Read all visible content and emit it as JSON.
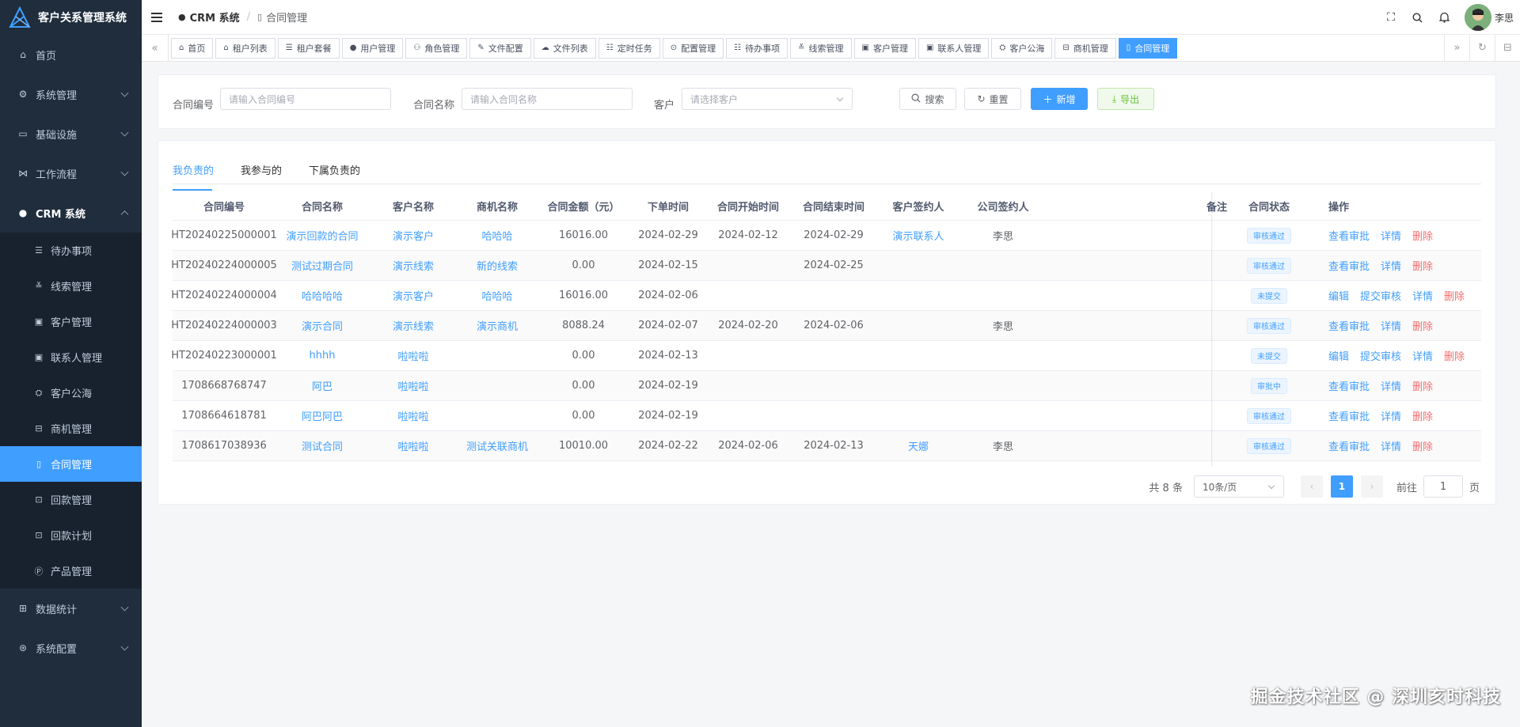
{
  "app": {
    "title": "客户关系管理系统"
  },
  "sidebar": {
    "items": [
      {
        "label": "首页",
        "icon": "home-icon"
      },
      {
        "label": "系统管理",
        "icon": "gear-icon",
        "arrow": "down"
      },
      {
        "label": "基础设施",
        "icon": "monitor-icon",
        "arrow": "down"
      },
      {
        "label": "工作流程",
        "icon": "flow-icon",
        "arrow": "down"
      },
      {
        "label": "CRM 系统",
        "icon": "user-icon",
        "arrow": "up"
      }
    ],
    "sub_items": [
      {
        "label": "待办事项",
        "icon": "list-icon"
      },
      {
        "label": "线索管理",
        "icon": "clue-icon"
      },
      {
        "label": "客户管理",
        "icon": "customer-icon"
      },
      {
        "label": "联系人管理",
        "icon": "contact-icon"
      },
      {
        "label": "客户公海",
        "icon": "sea-icon"
      },
      {
        "label": "商机管理",
        "icon": "business-icon"
      },
      {
        "label": "合同管理",
        "icon": "contract-icon"
      },
      {
        "label": "回款管理",
        "icon": "payment-icon"
      },
      {
        "label": "回款计划",
        "icon": "plan-icon"
      },
      {
        "label": "产品管理",
        "icon": "product-icon"
      }
    ],
    "bottom_items": [
      {
        "label": "数据统计",
        "icon": "chart-icon",
        "arrow": "down"
      },
      {
        "label": "系统配置",
        "icon": "config-icon",
        "arrow": "down"
      }
    ]
  },
  "navbar": {
    "breadcrumb": [
      "CRM 系统",
      "合同管理"
    ],
    "user_name": "李思"
  },
  "tags": [
    "首页",
    "租户列表",
    "租户套餐",
    "用户管理",
    "角色管理",
    "文件配置",
    "文件列表",
    "定时任务",
    "配置管理",
    "待办事项",
    "线索管理",
    "客户管理",
    "联系人管理",
    "客户公海",
    "商机管理",
    "合同管理"
  ],
  "search": {
    "contract_no_label": "合同编号",
    "contract_no_placeholder": "请输入合同编号",
    "contract_name_label": "合同名称",
    "contract_name_placeholder": "请输入合同名称",
    "customer_label": "客户",
    "customer_placeholder": "请选择客户",
    "search_btn": "搜索",
    "reset_btn": "重置",
    "add_btn": "新增",
    "export_btn": "导出"
  },
  "tabs": [
    "我负责的",
    "我参与的",
    "下属负责的"
  ],
  "table": {
    "columns": [
      "合同编号",
      "合同名称",
      "客户名称",
      "商机名称",
      "合同金额（元）",
      "下单时间",
      "合同开始时间",
      "合同结束时间",
      "客户签约人",
      "公司签约人",
      "备注",
      "合同状态",
      "操作"
    ],
    "rows": [
      {
        "no": "HT20240225000001",
        "name": "演示回款的合同",
        "customer": "演示客户",
        "business": "哈哈哈",
        "amount": "16016.00",
        "order": "2024-02-29",
        "start": "2024-02-12",
        "end": "2024-02-29",
        "cust_signer": "演示联系人",
        "comp_signer": "李思",
        "remark": "",
        "status": "审核通过",
        "ops": [
          "查看审批",
          "详情",
          "删除"
        ]
      },
      {
        "no": "HT20240224000005",
        "name": "测试过期合同",
        "customer": "演示线索",
        "business": "新的线索",
        "amount": "0.00",
        "order": "2024-02-15",
        "start": "",
        "end": "2024-02-25",
        "cust_signer": "",
        "comp_signer": "",
        "remark": "",
        "status": "审核通过",
        "ops": [
          "查看审批",
          "详情",
          "删除"
        ]
      },
      {
        "no": "HT20240224000004",
        "name": "哈哈哈哈",
        "customer": "演示客户",
        "business": "哈哈哈",
        "amount": "16016.00",
        "order": "2024-02-06",
        "start": "",
        "end": "",
        "cust_signer": "",
        "comp_signer": "",
        "remark": "",
        "status": "未提交",
        "ops": [
          "编辑",
          "提交审核",
          "详情",
          "删除"
        ]
      },
      {
        "no": "HT20240224000003",
        "name": "演示合同",
        "customer": "演示线索",
        "business": "演示商机",
        "amount": "8088.24",
        "order": "2024-02-07",
        "start": "2024-02-20",
        "end": "2024-02-06",
        "cust_signer": "",
        "comp_signer": "李思",
        "remark": "",
        "status": "审核通过",
        "ops": [
          "查看审批",
          "详情",
          "删除"
        ]
      },
      {
        "no": "HT20240223000001",
        "name": "hhhh",
        "customer": "啦啦啦",
        "business": "",
        "amount": "0.00",
        "order": "2024-02-13",
        "start": "",
        "end": "",
        "cust_signer": "",
        "comp_signer": "",
        "remark": "",
        "status": "未提交",
        "ops": [
          "编辑",
          "提交审核",
          "详情",
          "删除"
        ]
      },
      {
        "no": "1708668768747",
        "name": "阿巴",
        "customer": "啦啦啦",
        "business": "",
        "amount": "0.00",
        "order": "2024-02-19",
        "start": "",
        "end": "",
        "cust_signer": "",
        "comp_signer": "",
        "remark": "",
        "status": "审批中",
        "ops": [
          "查看审批",
          "详情",
          "删除"
        ]
      },
      {
        "no": "1708664618781",
        "name": "阿巴阿巴",
        "customer": "啦啦啦",
        "business": "",
        "amount": "0.00",
        "order": "2024-02-19",
        "start": "",
        "end": "",
        "cust_signer": "",
        "comp_signer": "",
        "remark": "",
        "status": "审核通过",
        "ops": [
          "查看审批",
          "详情",
          "删除"
        ]
      },
      {
        "no": "1708617038936",
        "name": "测试合同",
        "customer": "啦啦啦",
        "business": "测试关联商机",
        "amount": "10010.00",
        "order": "2024-02-22",
        "start": "2024-02-06",
        "end": "2024-02-13",
        "cust_signer": "天娜",
        "comp_signer": "李思",
        "remark": "",
        "status": "审核通过",
        "ops": [
          "查看审批",
          "详情",
          "删除"
        ]
      }
    ]
  },
  "pagination": {
    "total": "共 8 条",
    "page_size": "10条/页",
    "current": "1",
    "goto_label": "前往",
    "goto_value": "1",
    "page_unit": "页"
  },
  "watermark": "掘金技术社区 @ 深圳亥时科技",
  "colors": {
    "primary": "#409eff",
    "sidebar_bg": "#1f2d3d",
    "danger": "#f56c6c",
    "success": "#67c23a"
  }
}
